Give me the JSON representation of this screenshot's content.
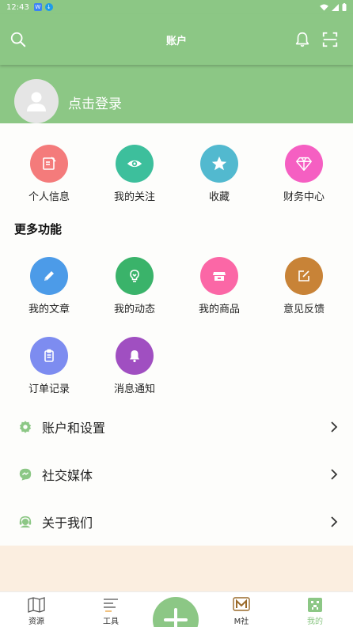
{
  "status_bar": {
    "time": "12:43"
  },
  "header": {
    "title": "账户"
  },
  "profile": {
    "login_text": "点击登录"
  },
  "quick_actions": [
    {
      "label": "个人信息",
      "icon": "edit-document-icon",
      "color": "#f47b7b"
    },
    {
      "label": "我的关注",
      "icon": "eye-icon",
      "color": "#3dbf9c"
    },
    {
      "label": "收藏",
      "icon": "star-icon",
      "color": "#52b9cf"
    },
    {
      "label": "财务中心",
      "icon": "diamond-icon",
      "color": "#f55fc2"
    }
  ],
  "more_functions": {
    "title": "更多功能",
    "items": [
      {
        "label": "我的文章",
        "icon": "pencil-icon",
        "color": "#4c9be8"
      },
      {
        "label": "我的动态",
        "icon": "lightbulb-icon",
        "color": "#3ab36a"
      },
      {
        "label": "我的商品",
        "icon": "store-icon",
        "color": "#fb67a6"
      },
      {
        "label": "意见反馈",
        "icon": "feedback-edit-icon",
        "color": "#c88337"
      },
      {
        "label": "订单记录",
        "icon": "clipboard-icon",
        "color": "#7d8cf0"
      },
      {
        "label": "消息通知",
        "icon": "bell-icon",
        "color": "#a04fc1"
      }
    ]
  },
  "menu": [
    {
      "label": "账户和设置",
      "icon": "gear-icon"
    },
    {
      "label": "社交媒体",
      "icon": "chat-icon"
    },
    {
      "label": "关于我们",
      "icon": "support-agent-icon"
    }
  ],
  "bottom_nav": [
    {
      "label": "资源",
      "icon": "map-icon"
    },
    {
      "label": "工具",
      "icon": "tools-icon"
    },
    {
      "label": "M社",
      "icon": "m-community-icon"
    },
    {
      "label": "我的",
      "icon": "profile-face-icon"
    }
  ],
  "colors": {
    "primary": "#8cc785",
    "footer_bg": "#fbeee0"
  }
}
